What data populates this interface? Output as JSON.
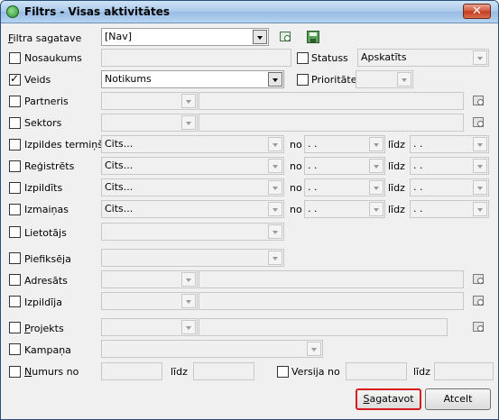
{
  "window": {
    "title": "Filtrs - Visas aktivitātes",
    "close_glyph": "✕"
  },
  "template": {
    "label_prefix": "F",
    "label_rest": "iltra sagatave",
    "value": "[Nav]"
  },
  "rows": {
    "nosaukums": {
      "label": "Nosaukums",
      "checked": false
    },
    "statuss": {
      "label": "Statuss",
      "value": "Apskatīts",
      "checked": false
    },
    "veids": {
      "label": "Veids",
      "value": "Notikums",
      "checked": true
    },
    "prioritate": {
      "label": "Prioritāte",
      "checked": false
    },
    "partneris": {
      "label": "Partneris",
      "checked": false
    },
    "sektors": {
      "label": "Sektors",
      "checked": false
    },
    "izpildes_termins": {
      "label": "Izpildes termiņš",
      "value": "Cits...",
      "no_label": "no",
      "no_value": ". .",
      "lidz_label": "līdz",
      "lidz_value": ". .",
      "checked": false
    },
    "registrets": {
      "label": "Reģistrēts",
      "value": "Cits...",
      "no_label": "no",
      "no_value": ". .",
      "lidz_label": "līdz",
      "lidz_value": ". .",
      "checked": false
    },
    "izpildits": {
      "label": "Izpildīts",
      "value": "Cits...",
      "no_label": "no",
      "no_value": ". .",
      "lidz_label": "līdz",
      "lidz_value": ". .",
      "checked": false
    },
    "izmainas": {
      "label": "Izmaiņas",
      "value": "Cits...",
      "no_label": "no",
      "no_value": ". .",
      "lidz_label": "līdz",
      "lidz_value": ". .",
      "checked": false
    },
    "lietotajs": {
      "label": "Lietotājs",
      "checked": false
    },
    "piefikseja": {
      "label": "Piefiksēja",
      "checked": false
    },
    "adresats": {
      "label": "Adresāts",
      "checked": false
    },
    "izpildija": {
      "label": "Izpildīja",
      "checked": false
    },
    "projekts": {
      "label_prefix": "P",
      "label_rest": "rojekts",
      "checked": false
    },
    "kampana": {
      "label": "Kampaņa",
      "checked": false
    },
    "numurs": {
      "label_prefix": "N",
      "label_rest": "umurs no",
      "lidz_label": "līdz",
      "checked": false
    },
    "versija": {
      "label": "Versija no",
      "lidz_label": "līdz",
      "checked": false
    }
  },
  "buttons": {
    "create_prefix": "S",
    "create_rest": "agatavot",
    "cancel": "Atcelt"
  },
  "colors": {
    "default_button_border": "#d21e1e",
    "titlebar": "#a9c9ea"
  }
}
